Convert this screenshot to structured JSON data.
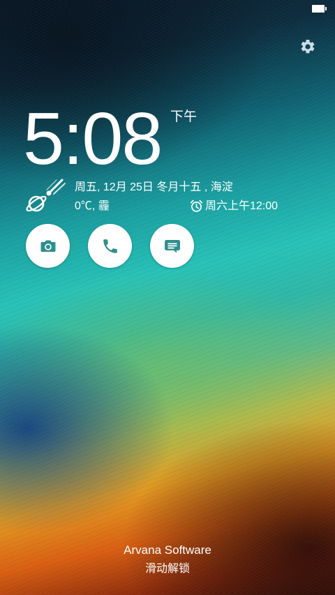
{
  "status_bar": {
    "battery_icon": "battery-icon"
  },
  "settings": {
    "icon": "gear-icon"
  },
  "clock": {
    "time": "5:08",
    "ampm": "下午"
  },
  "weather": {
    "icon": "haze-weather-icon",
    "date_line": "周五, 12月 25日 冬月十五 , 海淀",
    "temp_line": "0℃, 霾"
  },
  "alarm": {
    "icon": "alarm-clock-icon",
    "text": "周六上午12:00"
  },
  "quick_actions": [
    {
      "name": "camera",
      "icon": "camera-icon"
    },
    {
      "name": "phone",
      "icon": "phone-icon"
    },
    {
      "name": "messages",
      "icon": "message-icon"
    }
  ],
  "footer": {
    "company": "Arvana Software",
    "unlock_hint": "滑动解锁"
  },
  "colors": {
    "icon_accent": "#2e8f8d",
    "text": "#ffffff"
  }
}
